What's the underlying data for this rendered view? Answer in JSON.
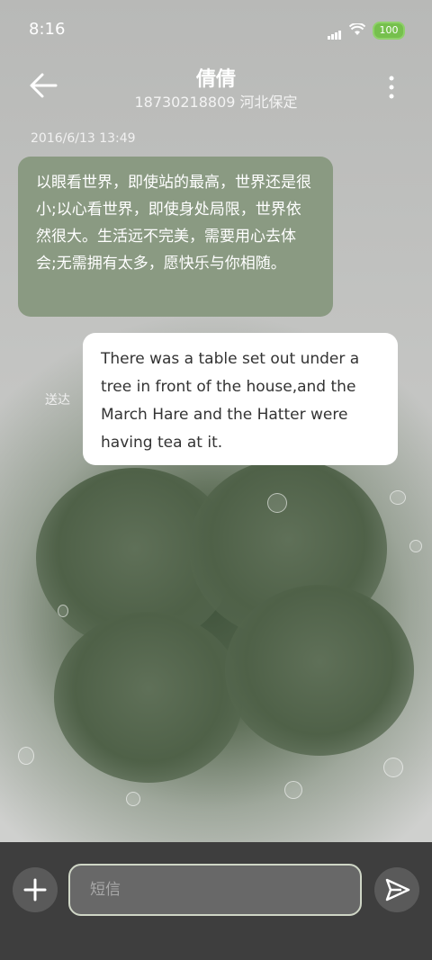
{
  "status_bar": {
    "time": "8:16",
    "battery": "100"
  },
  "header": {
    "title": "倩倩",
    "subtitle": "18730218809 河北保定"
  },
  "conversation": {
    "timestamp": "2016/6/13 13:49",
    "incoming_message": "以眼看世界，即使站的最高，世界还是很小;以心看世界，即使身处局限，世界依然很大。生活远不完美，需要用心去体会;无需拥有太多，愿快乐与你相随。",
    "outgoing_message": "There was a table set out under a tree in front of the house,and the March Hare and the Hatter were having tea at it.",
    "sent_status": "送达"
  },
  "composer": {
    "placeholder": "短信"
  },
  "icons": {
    "back": "arrow-left-icon",
    "more": "more-vertical-icon",
    "add": "plus-icon",
    "send": "send-icon",
    "signal": "signal-icon",
    "wifi": "wifi-icon",
    "battery": "battery-icon"
  },
  "colors": {
    "incoming_bubble": "#8a9a82",
    "outgoing_bubble": "#ffffff",
    "battery": "#76c04d",
    "bottom_bar": "#3e3e3e"
  }
}
